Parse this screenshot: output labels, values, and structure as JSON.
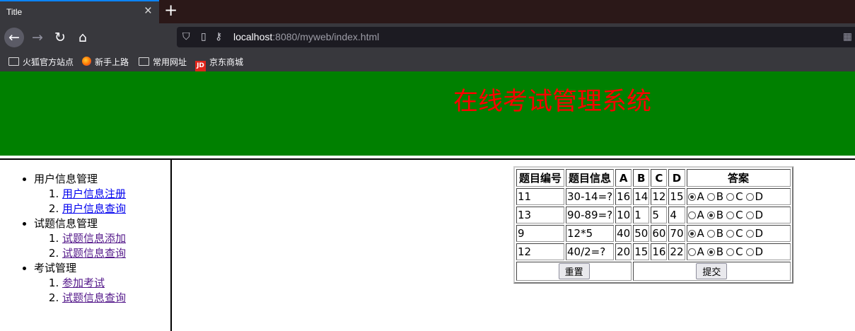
{
  "browser": {
    "tab_title": "Title",
    "tab_close": "×",
    "new_tab": "+",
    "url_host": "localhost",
    "url_rest": ":8080/myweb/index.html",
    "bookmarks": [
      "火狐官方站点",
      "新手上路",
      "常用网址",
      "京东商城"
    ]
  },
  "page": {
    "header_title": "在线考试管理系统",
    "menu": [
      {
        "label": "用户信息管理",
        "items": [
          "用户信息注册",
          "用户信息查询"
        ]
      },
      {
        "label": "试题信息管理",
        "items": [
          "试题信息添加",
          "试题信息查询"
        ]
      },
      {
        "label": "考试管理",
        "items": [
          "参加考试",
          "试题信息查询"
        ]
      }
    ],
    "table": {
      "headers": [
        "题目编号",
        "题目信息",
        "A",
        "B",
        "C",
        "D",
        "答案"
      ],
      "rows": [
        {
          "id": "11",
          "question": "30-14=?",
          "a": "16",
          "b": "14",
          "c": "12",
          "d": "15",
          "selected": "A"
        },
        {
          "id": "13",
          "question": "90-89=?",
          "a": "10",
          "b": "1",
          "c": "5",
          "d": "4",
          "selected": "B"
        },
        {
          "id": "9",
          "question": "12*5",
          "a": "40",
          "b": "50",
          "c": "60",
          "d": "70",
          "selected": "A"
        },
        {
          "id": "12",
          "question": "40/2=?",
          "a": "20",
          "b": "15",
          "c": "16",
          "d": "22",
          "selected": "B"
        }
      ],
      "option_labels": [
        "A",
        "B",
        "C",
        "D"
      ],
      "reset_label": "重置",
      "submit_label": "提交"
    }
  }
}
